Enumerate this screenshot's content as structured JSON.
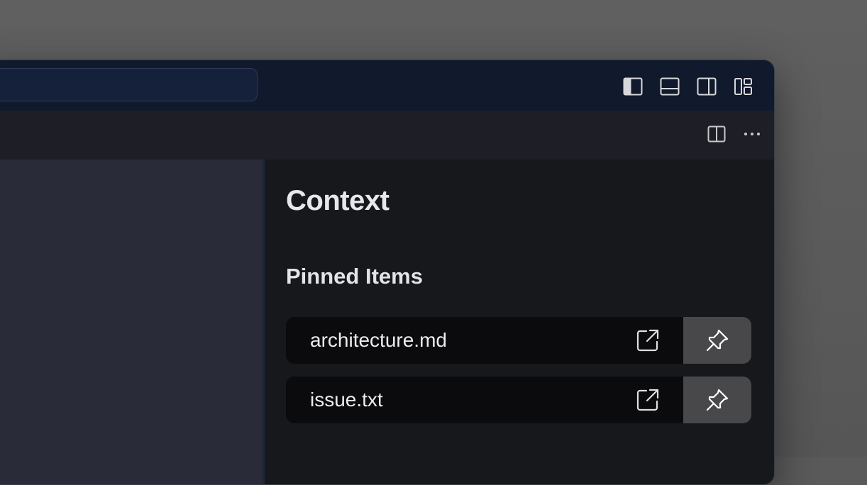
{
  "titlebar": {
    "layout_buttons": [
      {
        "icon": "toggle-primary-sidebar-icon"
      },
      {
        "icon": "toggle-panel-icon"
      },
      {
        "icon": "toggle-secondary-sidebar-icon"
      },
      {
        "icon": "customize-layout-icon"
      }
    ]
  },
  "tabbar": {
    "actions": [
      {
        "icon": "split-editor-icon"
      },
      {
        "icon": "more-actions-icon"
      }
    ]
  },
  "context_panel": {
    "title": "Context",
    "pinned_section_title": "Pinned Items",
    "pinned_items": [
      {
        "label": "architecture.md",
        "open_icon": "open-external-icon",
        "pin_icon": "pin-icon"
      },
      {
        "label": "issue.txt",
        "open_icon": "open-external-icon",
        "pin_icon": "pin-icon"
      }
    ]
  },
  "colors": {
    "titlebar": "#101a2c",
    "tabbar": "#1e1e27",
    "left_panel": "#292c38",
    "right_panel": "#17181c",
    "item_bg": "#0b0b0d",
    "pin_bg": "#48484b",
    "text": "#ececef"
  }
}
